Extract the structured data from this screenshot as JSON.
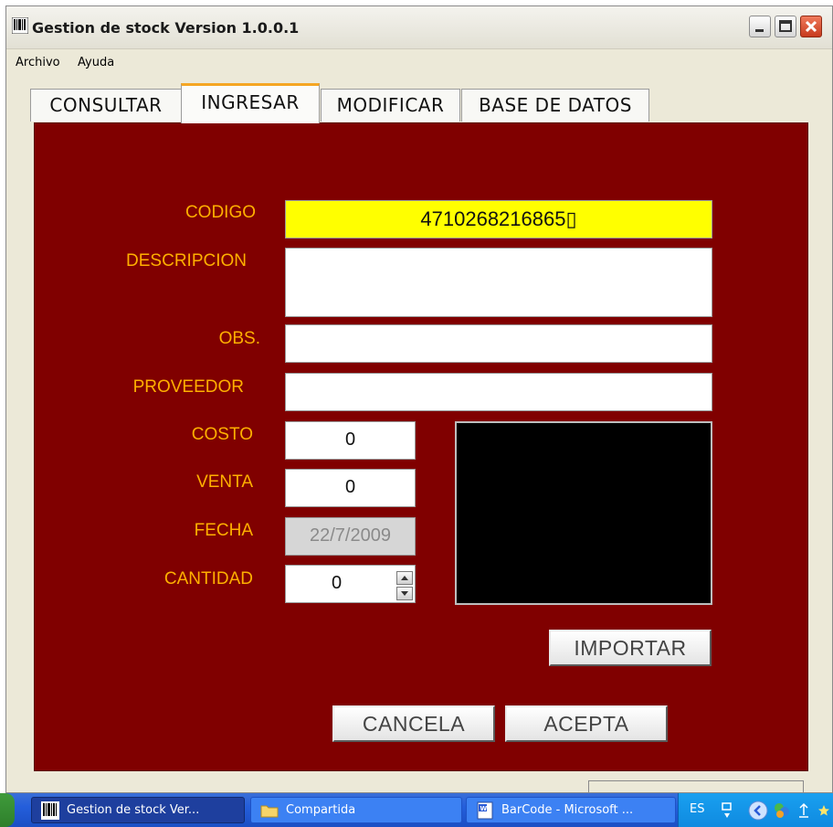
{
  "window": {
    "title": "Gestion de stock Version 1.0.0.1"
  },
  "menu": [
    "Archivo",
    "Ayuda"
  ],
  "tabs": [
    "CONSULTAR",
    "INGRESAR",
    "MODIFICAR",
    "BASE DE DATOS"
  ],
  "active_tab": "INGRESAR",
  "form": {
    "codigo_label": "CODIGO",
    "codigo_value": "4710268216865▯",
    "descripcion_label": "DESCRIPCION",
    "descripcion_value": "",
    "obs_label": "OBS.",
    "obs_value": "",
    "proveedor_label": "PROVEEDOR",
    "proveedor_value": "",
    "costo_label": "COSTO",
    "costo_value": "0",
    "venta_label": "VENTA",
    "venta_value": "0",
    "fecha_label": "FECHA",
    "fecha_value": "22/7/2009",
    "cantidad_label": "CANTIDAD",
    "cantidad_value": "0"
  },
  "buttons": {
    "importar": "IMPORTAR",
    "cancela": "CANCELA",
    "acepta": "ACEPTA"
  },
  "taskbar": {
    "items": [
      "Gestion de stock Ver...",
      "Compartida",
      "BarCode - Microsoft ..."
    ],
    "language": "ES"
  },
  "colors": {
    "panel": "#800000",
    "label": "#ffb000",
    "codigo_field": "#ffff00",
    "taskbar": "#245edb"
  },
  "icons": {
    "app": "barcode-icon",
    "folder": "folder-icon",
    "word": "word-document-icon"
  }
}
